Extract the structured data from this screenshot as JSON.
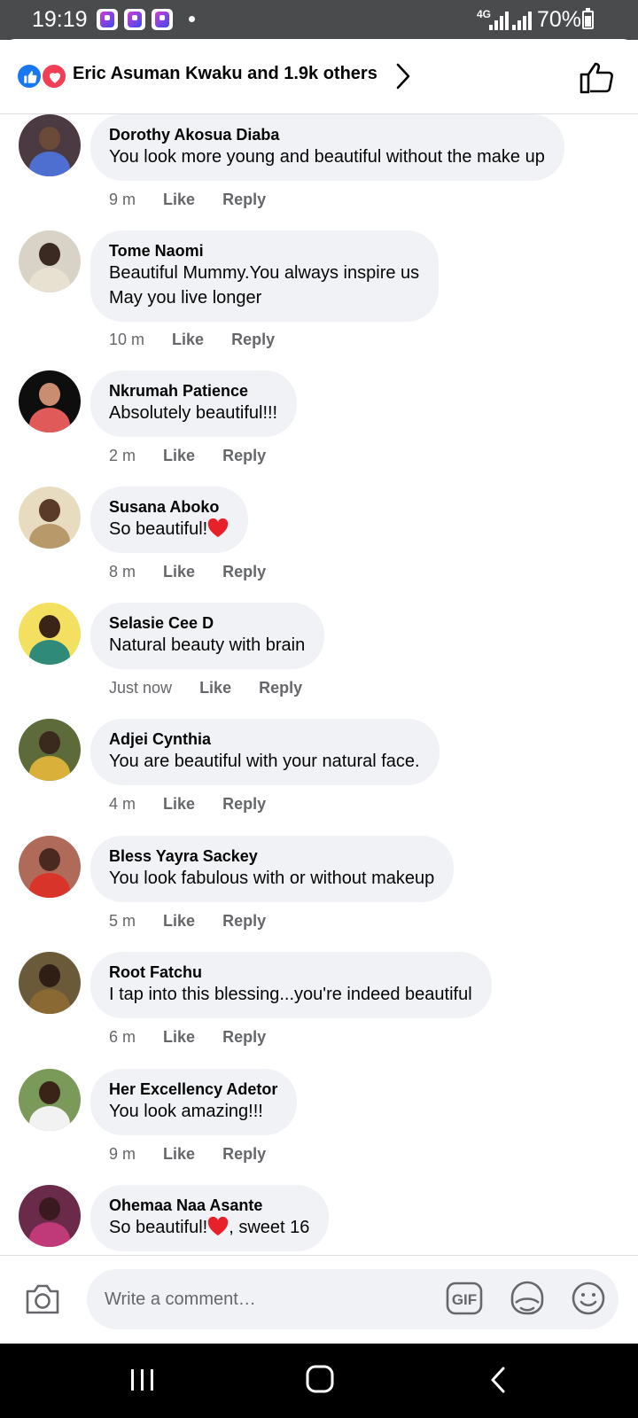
{
  "status_bar": {
    "time": "19:19",
    "network": "4G",
    "battery": "70%"
  },
  "header": {
    "reactions_text": "Eric Asuman Kwaku and 1.9k others"
  },
  "comments": [
    {
      "author": "Dorothy Akosua Diaba",
      "lines": [
        "You look more young and beautiful without the make up"
      ],
      "time": "9 m",
      "like": "Like",
      "reply": "Reply"
    },
    {
      "author": "Tome Naomi",
      "lines": [
        "Beautiful Mummy.You always inspire us",
        "May you live longer"
      ],
      "time": "10 m",
      "like": "Like",
      "reply": "Reply"
    },
    {
      "author": "Nkrumah Patience",
      "lines": [
        "Absolutely beautiful!!!"
      ],
      "time": "2 m",
      "like": "Like",
      "reply": "Reply"
    },
    {
      "author": "Susana Aboko",
      "lines": [
        "So beautiful!"
      ],
      "time": "8 m",
      "like": "Like",
      "reply": "Reply",
      "heart": true
    },
    {
      "author": "Selasie Cee D",
      "lines": [
        "Natural beauty with brain"
      ],
      "time": "Just now",
      "like": "Like",
      "reply": "Reply"
    },
    {
      "author": "Adjei Cynthia",
      "lines": [
        "You are beautiful with your natural face."
      ],
      "time": "4 m",
      "like": "Like",
      "reply": "Reply"
    },
    {
      "author": "Bless Yayra Sackey",
      "lines": [
        "You look fabulous with or without makeup"
      ],
      "time": "5 m",
      "like": "Like",
      "reply": "Reply"
    },
    {
      "author": "Root Fatchu",
      "lines": [
        "I tap into this blessing...you're indeed beautiful"
      ],
      "time": "6 m",
      "like": "Like",
      "reply": "Reply"
    },
    {
      "author": "Her Excellency Adetor",
      "lines": [
        "You look amazing!!!"
      ],
      "time": "9 m",
      "like": "Like",
      "reply": "Reply"
    },
    {
      "author": "Ohemaa Naa Asante",
      "lines": [
        "So beautiful!",
        ", sweet 16"
      ],
      "time": "",
      "like": "",
      "reply": "",
      "heart_inline": true
    }
  ],
  "composer": {
    "placeholder": "Write a comment…",
    "gif_label": "GIF"
  },
  "colors": {
    "status_bar": "#4a4b4d",
    "bubble": "#f0f2f5",
    "meta_text": "#65676b",
    "like_blue": "#1877f2",
    "love_red": "#f33e58"
  },
  "icons": [
    "like-reaction-icon",
    "love-reaction-icon",
    "chevron-right-icon",
    "thumbs-up-icon",
    "camera-icon",
    "gif-icon",
    "sticker-icon",
    "emoji-icon",
    "heart-emoji-icon",
    "recents-icon",
    "home-icon",
    "back-icon"
  ]
}
